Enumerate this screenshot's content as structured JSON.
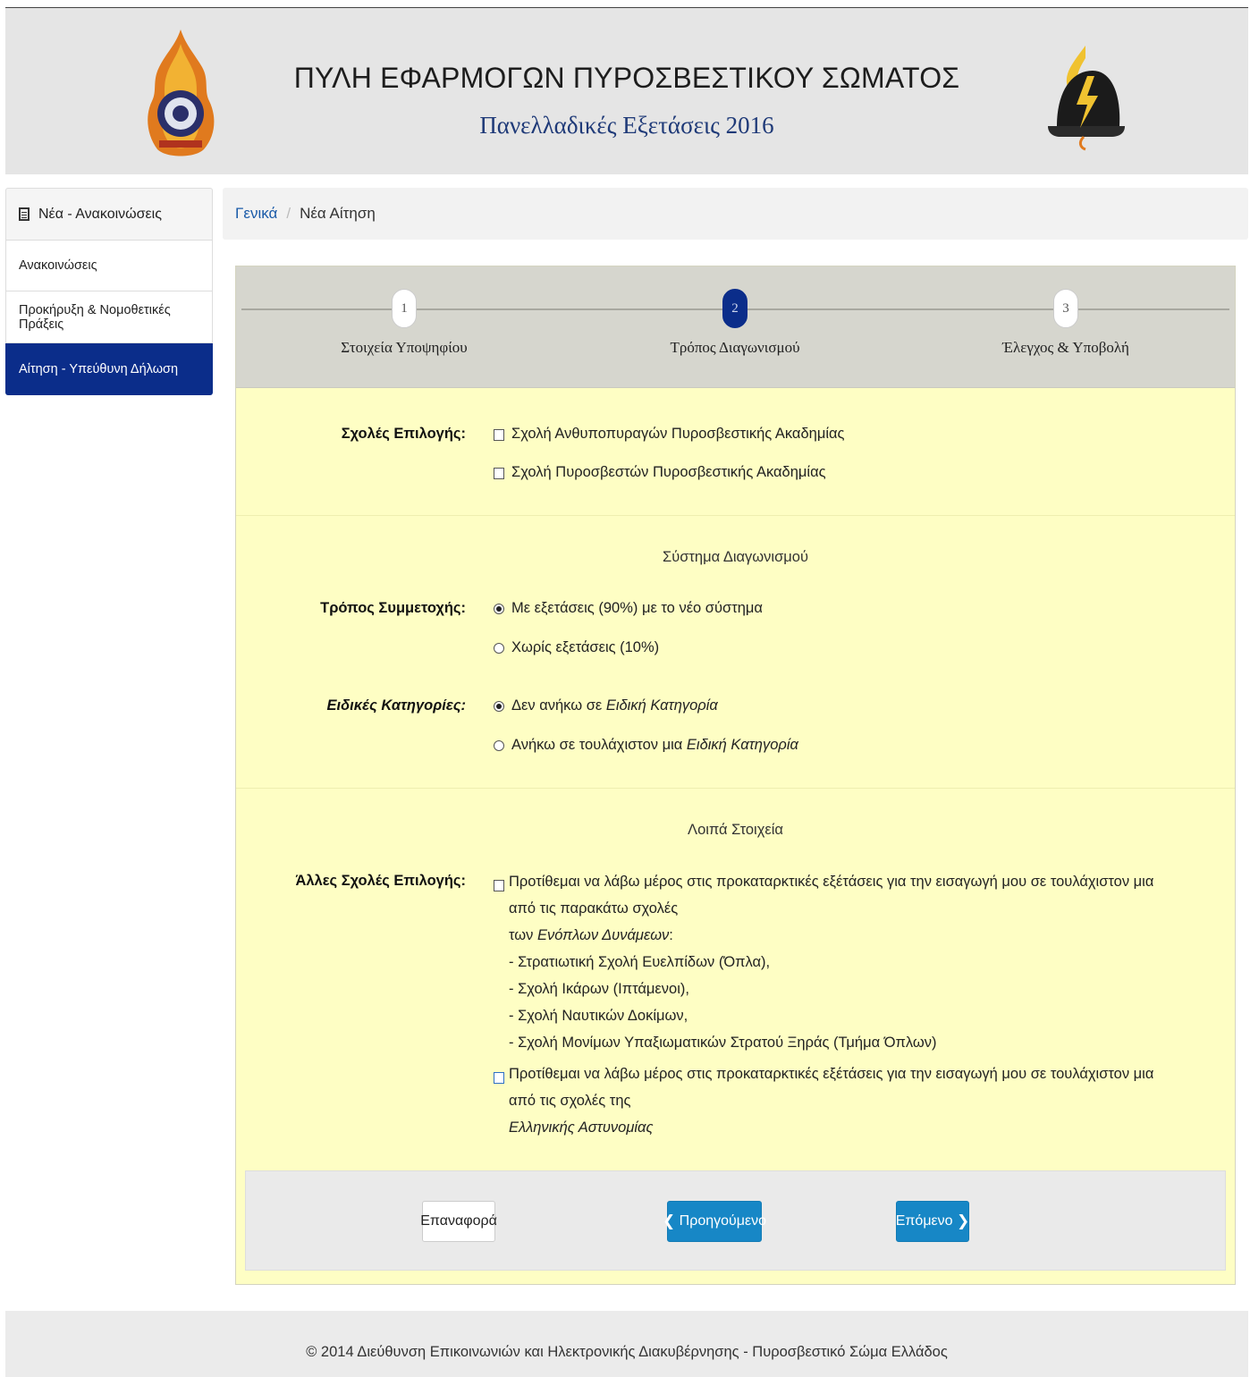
{
  "header": {
    "title": "ΠΥΛΗ ΕΦΑΡΜΟΓΩΝ ΠΥΡΟΣΒΕΣΤΙΚΟΥ ΣΩΜΑΤΟΣ",
    "subtitle": "Πανελλαδικές Εξετάσεις 2016",
    "logo_left": "fire-brigade-emblem",
    "logo_right": "firefighter-helmet-logo"
  },
  "sidebar": {
    "heading": "Νέα - Ανακοινώσεις",
    "heading_icon": "document-icon",
    "items": [
      {
        "label": "Ανακοινώσεις"
      },
      {
        "label": "Προκήρυξη & Νομοθετικές Πράξεις"
      },
      {
        "label": "Αίτηση - Υπεύθυνη Δήλωση"
      }
    ],
    "active_index": 2,
    "active_color": "#0b2d8a"
  },
  "breadcrumb": {
    "home": "Γενικά",
    "separator": "/",
    "current": "Νέα Αίτηση"
  },
  "wizard": {
    "steps": [
      {
        "number": "1",
        "label": "Στοιχεία Υποψηφίου"
      },
      {
        "number": "2",
        "label": "Τρόπος Διαγωνισμού"
      },
      {
        "number": "3",
        "label": "Έλεγχος & Υποβολή"
      }
    ],
    "active_step": 2
  },
  "form": {
    "schools": {
      "label": "Σχολές Επιλογής:",
      "options": [
        {
          "text": "Σχολή Ανθυποπυραγών Πυροσβεστικής Ακαδημίας",
          "checked": false
        },
        {
          "text": "Σχολή Πυροσβεστών Πυροσβεστικής Ακαδημίας",
          "checked": false
        }
      ]
    },
    "system_title": "Σύστημα Διαγωνισμού",
    "participation": {
      "label": "Τρόπος Συμμετοχής:",
      "options": [
        {
          "text": "Με εξετάσεις (90%) με το νέο σύστημα",
          "selected": true
        },
        {
          "text": "Χωρίς εξετάσεις (10%)",
          "selected": false
        }
      ]
    },
    "special": {
      "label": "Ειδικές Κατηγορίες:",
      "option1_prefix": "Δεν ανήκω σε ",
      "option1_italic": "Ειδική Κατηγορία",
      "option1_selected": true,
      "option2_prefix": "Ανήκω σε τουλάχιστον μια ",
      "option2_italic": "Ειδική Κατηγορία",
      "option2_selected": false
    },
    "other_title": "Λοιπά Στοιχεία",
    "other_schools": {
      "label": "Άλλες Σχολές Επιλογής:",
      "armed_line1": "Προτίθεμαι να λάβω μέρος στις προκαταρκτικές εξέτάσεις για την εισαγωγή μου σε τουλάχιστον μια από τις παρακάτω σχολές",
      "armed_line2_prefix": "των ",
      "armed_line2_italic": "Ενόπλων Δυνάμεων",
      "armed_line2_suffix": ":",
      "armed_list": [
        "- Στρατιωτική Σχολή Ευελπίδων (Όπλα),",
        "- Σχολή Ικάρων (Ιπτάμενοι),",
        "- Σχολή Ναυτικών Δοκίμων,",
        "- Σχολή Μονίμων Υπαξιωματικών Στρατού Ξηράς (Τμήμα Όπλων)"
      ],
      "armed_checked": false,
      "police_line1": "Προτίθεμαι να λάβω μέρος στις προκαταρκτικές εξέτάσεις για την εισαγωγή μου σε τουλάχιστον μια από τις σχολές της",
      "police_line2_italic": "Ελληνικής Αστυνομίας",
      "police_checked": false
    }
  },
  "buttons": {
    "reset": "Επαναφορά",
    "prev": "Προηγούμενο",
    "next": "Επόμενο",
    "prev_icon": "chevron-left-icon",
    "next_icon": "chevron-right-icon",
    "primary_color": "#1787c6"
  },
  "footer": {
    "text": "© 2014 Διεύθυνση Επικοινωνιών και Ηλεκτρονικής Διακυβέρνησης - Πυροσβεστικό Σώμα Ελλάδος"
  }
}
